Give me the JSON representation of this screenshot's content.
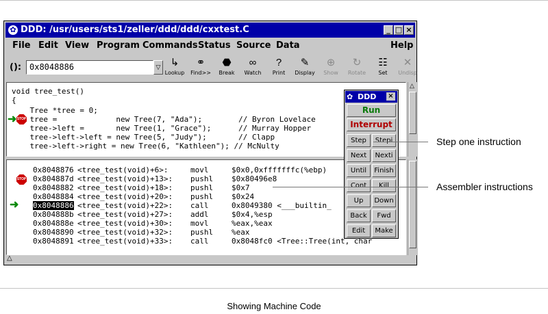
{
  "window": {
    "title": "DDD: /usr/users/sts1/zeller/ddd/ddd/cxxtest.C",
    "icon": "ddd-icon"
  },
  "menubar": [
    "File",
    "Edit",
    "View",
    "Program",
    "Commands",
    "Status",
    "Source",
    "Data",
    "Help"
  ],
  "argument": {
    "label": "():",
    "value": "0x8048886"
  },
  "toolbar": [
    "Lookup",
    "Find>>",
    "Break",
    "Watch",
    "Print",
    "Display",
    "Show",
    "Rotate",
    "Set",
    "Undisp"
  ],
  "source_lines": [
    "void tree_test()",
    "{",
    "    Tree *tree = 0;",
    "    tree =             new Tree(7, \"Ada\");        // Byron Lovelace",
    "    tree->left =       new Tree(1, \"Grace\");      // Murray Hopper",
    "    tree->left->left = new Tree(5, \"Judy\");       // Clapp",
    "    tree->left->right = new Tree(6, \"Kathleen\"); // McNulty"
  ],
  "asm_lines": [
    {
      "addr": "0x8048876",
      "func": "<tree_test(void)+6>:",
      "op": "movl",
      "args": "$0x0,0xfffffffc(%ebp)"
    },
    {
      "addr": "0x804887d",
      "func": "<tree_test(void)+13>:",
      "op": "pushl",
      "args": "$0x80496e8"
    },
    {
      "addr": "0x8048882",
      "func": "<tree_test(void)+18>:",
      "op": "pushl",
      "args": "$0x7"
    },
    {
      "addr": "0x8048884",
      "func": "<tree_test(void)+20>:",
      "op": "pushl",
      "args": "$0x24"
    },
    {
      "addr": "0x8048886",
      "func": "<tree_test(void)+22>:",
      "op": "call",
      "args": "0x8049380 <___builtin_"
    },
    {
      "addr": "0x804888b",
      "func": "<tree_test(void)+27>:",
      "op": "addl",
      "args": "$0x4,%esp"
    },
    {
      "addr": "0x804888e",
      "func": "<tree_test(void)+30>:",
      "op": "movl",
      "args": "%eax,%eax"
    },
    {
      "addr": "0x8048890",
      "func": "<tree_test(void)+32>:",
      "op": "pushl",
      "args": "%eax"
    },
    {
      "addr": "0x8048891",
      "func": "<tree_test(void)+33>:",
      "op": "call",
      "args": "0x8048fc0 <Tree::Tree(int, char"
    }
  ],
  "stop_label": "STOP",
  "command_panel": {
    "title": "DDD",
    "run": "Run",
    "interrupt": "Interrupt",
    "buttons": [
      "Step",
      "Stepi",
      "Next",
      "Nexti",
      "Until",
      "Finish",
      "Cont",
      "Kill",
      "Up",
      "Down",
      "Back",
      "Fwd",
      "Edit",
      "Make"
    ]
  },
  "callouts": {
    "step": "Step one instruction",
    "asm": "Assembler instructions"
  },
  "caption": "Showing Machine Code",
  "colors": {
    "titlebar": "#0000a8",
    "run": "#0a7a0a",
    "interrupt": "#b00000",
    "stop": "#cc0000",
    "arrow": "#0a8a0a"
  }
}
